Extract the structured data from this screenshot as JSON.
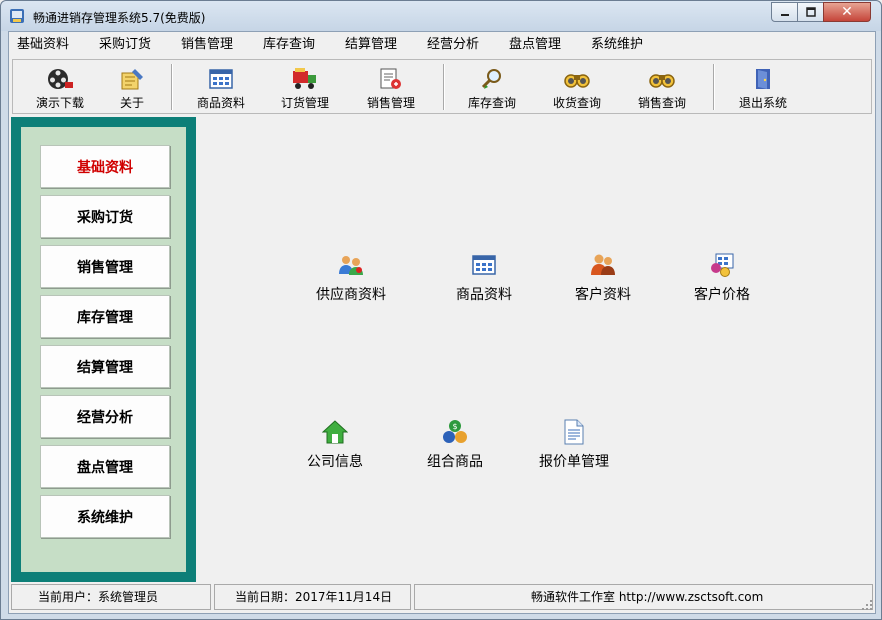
{
  "window": {
    "title": "畅通进销存管理系统5.7(免费版)",
    "controls": {
      "minimize": "-",
      "maximize": "□",
      "close": "✕"
    }
  },
  "menu": [
    "基础资料",
    "采购订货",
    "销售管理",
    "库存查询",
    "结算管理",
    "经营分析",
    "盘点管理",
    "系统维护"
  ],
  "toolbar": [
    {
      "label": "演示下载",
      "icon": "film-reel-icon"
    },
    {
      "label": "关于",
      "icon": "about-icon"
    },
    {
      "label": "商品资料",
      "icon": "grid-table-icon"
    },
    {
      "label": "订货管理",
      "icon": "truck-icon"
    },
    {
      "label": "销售管理",
      "icon": "sales-document-icon"
    },
    {
      "label": "库存查询",
      "icon": "magnifier-icon"
    },
    {
      "label": "收货查询",
      "icon": "binoculars-icon"
    },
    {
      "label": "销售查询",
      "icon": "binoculars-icon"
    },
    {
      "label": "退出系统",
      "icon": "exit-door-icon"
    }
  ],
  "sidebar": {
    "items": [
      "基础资料",
      "采购订货",
      "销售管理",
      "库存管理",
      "结算管理",
      "经营分析",
      "盘点管理",
      "系统维护"
    ],
    "active": "基础资料",
    "active_color": "#d00000",
    "frame_color": "#0d7f78",
    "panel_color": "#c6dec6"
  },
  "main": {
    "tiles": [
      {
        "label": "供应商资料",
        "icon": "suppliers-icon"
      },
      {
        "label": "商品资料",
        "icon": "grid-table-icon"
      },
      {
        "label": "客户资料",
        "icon": "customers-icon"
      },
      {
        "label": "客户价格",
        "icon": "price-icon"
      },
      {
        "label": "公司信息",
        "icon": "house-icon"
      },
      {
        "label": "组合商品",
        "icon": "coins-icon"
      },
      {
        "label": "报价单管理",
        "icon": "document-icon"
      }
    ]
  },
  "status": {
    "user": "当前用户：系统管理员",
    "date": "当前日期：2017年11月14日",
    "vendor": "畅通软件工作室 http://www.zsctsoft.com"
  }
}
